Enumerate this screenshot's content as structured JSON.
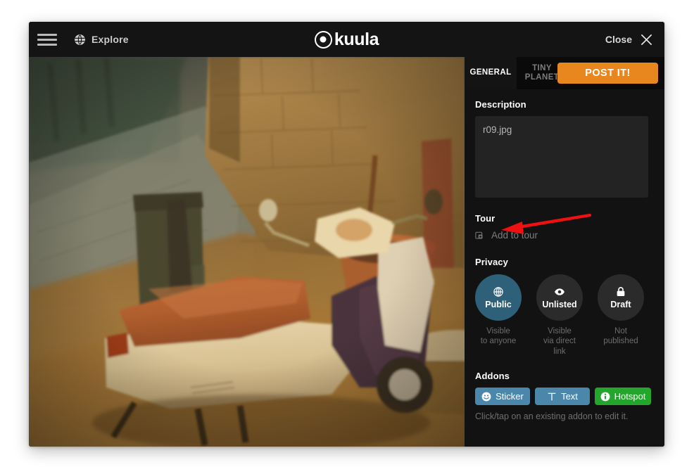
{
  "window": {
    "topbar": {
      "menu_icon": "hamburger-icon",
      "explore_icon": "globe-icon",
      "explore_label": "Explore",
      "brand_icon": "kuula-circle-dot-icon",
      "brand_text": "kuula",
      "close_label": "Close",
      "close_icon": "close-x-icon"
    },
    "photo": {
      "alt": "Night photo of a cream scooter with a tan seat parked beside a stone wall on a cobblestone alley, with a terracotta flower pot and a dark green waste bin"
    }
  },
  "panel": {
    "tabs": [
      {
        "label": "GENERAL",
        "active": true
      },
      {
        "label": "TINY\nPLANET",
        "active": false
      }
    ],
    "post_button": "POST IT!",
    "description": {
      "title": "Description",
      "value": "r09.jpg",
      "placeholder": "Description"
    },
    "tour": {
      "title": "Tour",
      "add_icon": "add-to-tour-icon",
      "add_label": "Add to tour"
    },
    "privacy": {
      "title": "Privacy",
      "options": [
        {
          "name": "Public",
          "icon": "globe-icon",
          "desc": "Visible\nto anyone",
          "active": true
        },
        {
          "name": "Unlisted",
          "icon": "eye-icon",
          "desc": "Visible\nvia direct link",
          "active": false
        },
        {
          "name": "Draft",
          "icon": "lock-icon",
          "desc": "Not published",
          "active": false
        }
      ]
    },
    "addons": {
      "title": "Addons",
      "buttons": [
        {
          "label": "Sticker",
          "icon": "smiley-icon",
          "color": "#4b87ab"
        },
        {
          "label": "Text",
          "icon": "text-t-icon",
          "color": "#4b87ab"
        },
        {
          "label": "Hotspot",
          "icon": "info-icon",
          "color": "#24a52c"
        }
      ],
      "hint": "Click/tap on an existing addon to edit it."
    }
  },
  "annotation": {
    "arrow_color": "#ee1111",
    "arrow_points_to": "Tour"
  },
  "colors": {
    "accent_orange": "#e8871e",
    "privacy_active": "#2e6179",
    "addon_blue": "#4b87ab",
    "addon_green": "#24a52c",
    "panel_bg": "#121212",
    "topbar_bg": "#141414"
  }
}
